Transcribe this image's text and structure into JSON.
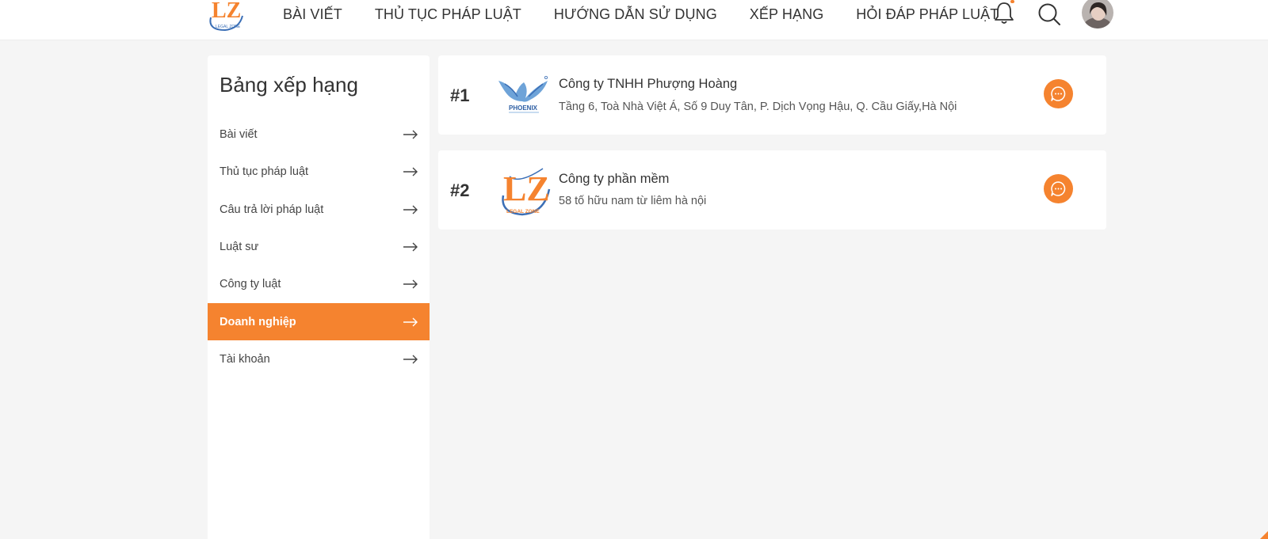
{
  "header": {
    "logo_text": "LZ",
    "logo_subtext": "LEGAL ZONE",
    "nav": [
      {
        "label": "BÀI VIẾT"
      },
      {
        "label": "THỦ TỤC PHÁP LUẬT"
      },
      {
        "label": "HƯỚNG DẪN SỬ DỤNG"
      },
      {
        "label": "XẾP HẠNG"
      },
      {
        "label": "HỎI ĐÁP PHÁP LUẬT"
      }
    ],
    "icons": {
      "notification": "bell-icon",
      "search": "search-icon",
      "avatar": "user-avatar"
    }
  },
  "sidebar": {
    "title": "Bảng xếp hạng",
    "items": [
      {
        "label": "Bài viết",
        "active": false
      },
      {
        "label": "Thủ tục pháp luật",
        "active": false
      },
      {
        "label": "Câu trả lời pháp luật",
        "active": false
      },
      {
        "label": "Luật sư",
        "active": false
      },
      {
        "label": "Công ty luật",
        "active": false
      },
      {
        "label": "Doanh nghiệp",
        "active": true
      },
      {
        "label": "Tài khoản",
        "active": false
      }
    ]
  },
  "rankings": [
    {
      "rank": "#1",
      "logo_text": "PHOENIX",
      "name": "Công ty TNHH Phượng Hoàng",
      "address": "Tầng 6, Toà Nhà Việt Á, Số 9 Duy Tân, P. Dịch Vọng Hậu, Q. Cầu Giấy,Hà Nội"
    },
    {
      "rank": "#2",
      "logo_text": "LZ",
      "logo_subtext": "LEGAL ZONE",
      "name": "Công ty phần mềm",
      "address": "58 tố hữu nam từ liêm hà nội"
    }
  ],
  "colors": {
    "accent": "#f5832f",
    "background": "#f5f5f5",
    "card": "#ffffff",
    "text": "#333333",
    "logo_blue": "#3b6fb6"
  }
}
